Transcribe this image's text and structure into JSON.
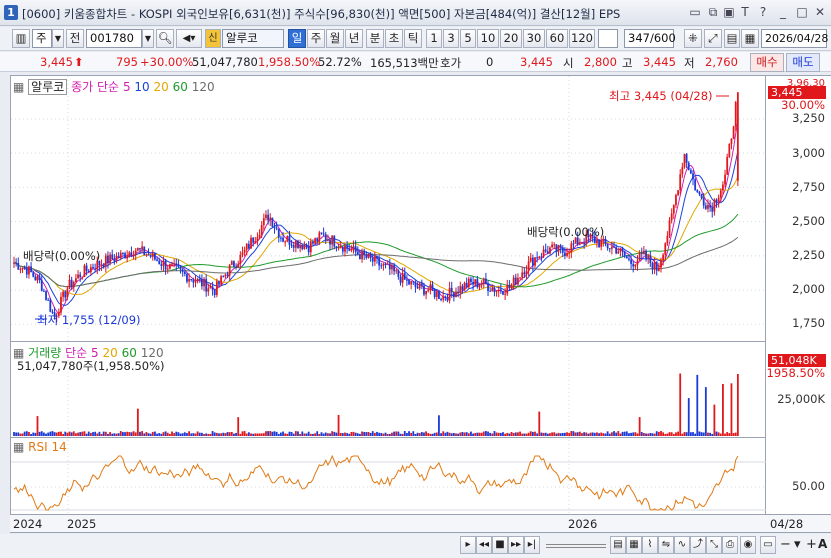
{
  "window": {
    "id": "1",
    "title": "[0600] 키움종합차트 - KOSPI 외국인보유[6,631(천)] 주식수[96,830(천)] 액면[500] 자본금[484(억)] 결산[12월] EPS"
  },
  "toolbar": {
    "market": "주",
    "prev_label": "전",
    "code": "001780",
    "sin_badge": "신",
    "stock_name": "알루코",
    "periods": [
      "일",
      "주",
      "월",
      "년",
      "분",
      "초",
      "틱"
    ],
    "intervals": [
      "1",
      "3",
      "5",
      "10",
      "20",
      "30",
      "60",
      "120"
    ],
    "count": "347",
    "count_total": "/600",
    "date": "2026/04/28"
  },
  "quote": {
    "price": "3,445",
    "change": "795",
    "change_pct": "+30.00%",
    "volume": "51,047,780",
    "volume_ratio": "1,958.50%",
    "turnover_ratio": "52.72%",
    "amount": "165,513백만",
    "hoga_label": "호가",
    "hoga_value": "0",
    "price2": "3,445",
    "open_label": "시",
    "open": "2,800",
    "high_label": "고",
    "high": "3,445",
    "low_label": "저",
    "low": "2,760",
    "buy_label": "매수",
    "sell_label": "매도"
  },
  "price_panel": {
    "legend_name": "알루코",
    "legend_ma": "종가 단순",
    "ma_periods": [
      "5",
      "10",
      "20",
      "60",
      "120"
    ],
    "ma_colors": [
      "#d11fb0",
      "#1c43d8",
      "#e1a800",
      "#1f9b2b",
      "#6c6c6c"
    ],
    "y_ticks": [
      "3,250",
      "3,000",
      "2,750",
      "2,500",
      "2,250",
      "2,000",
      "1,750"
    ],
    "y_top_cut": "3,96.30",
    "price_tag": "3,445",
    "pct_tag": "30.00%",
    "high_annotation": "최고 3,445 (04/28)",
    "low_annotation": "최저 1,755 (12/09)",
    "dividend_1": "배당락(0.00%)",
    "dividend_2": "배당락(0.00%)"
  },
  "volume_panel": {
    "legend_name": "거래량",
    "legend_ma": "단순",
    "ma_periods": [
      "5",
      "20",
      "60",
      "120"
    ],
    "value_line": "51,047,780주(1,958.50%)",
    "tag_value": "51,048K",
    "tag_pct": "1958.50%",
    "y_tick": "25,000K"
  },
  "rsi_panel": {
    "legend": "RSI 14",
    "y_tick": "50.00"
  },
  "x_axis": {
    "labels": [
      "2024",
      "2025",
      "2026"
    ],
    "last": "04/28"
  },
  "chart_data": {
    "type": "candlestick",
    "title": "알루코 (001780)",
    "ylim": [
      1650,
      3520
    ],
    "last": {
      "date": "2026/04/28",
      "open": 2800,
      "high": 3445,
      "low": 2760,
      "close": 3445
    },
    "period_high": {
      "value": 3445,
      "date": "04/28"
    },
    "period_low": {
      "value": 1755,
      "date": "12/09"
    },
    "approx_close_series": [
      2200,
      2150,
      2050,
      1800,
      2020,
      2120,
      2180,
      2220,
      2250,
      2300,
      2260,
      2200,
      2150,
      2100,
      2050,
      2000,
      2150,
      2250,
      2400,
      2550,
      2380,
      2350,
      2320,
      2400,
      2350,
      2300,
      2250,
      2200,
      2150,
      2080,
      2020,
      2000,
      1950,
      2000,
      2050,
      2050,
      2000,
      2020,
      2150,
      2250,
      2300,
      2280,
      2350,
      2380,
      2330,
      2300,
      2200,
      2250,
      2150,
      2500,
      3000,
      2700,
      2600,
      2800,
      3445
    ],
    "volume_last": 51047780,
    "rsi_level": 50
  }
}
